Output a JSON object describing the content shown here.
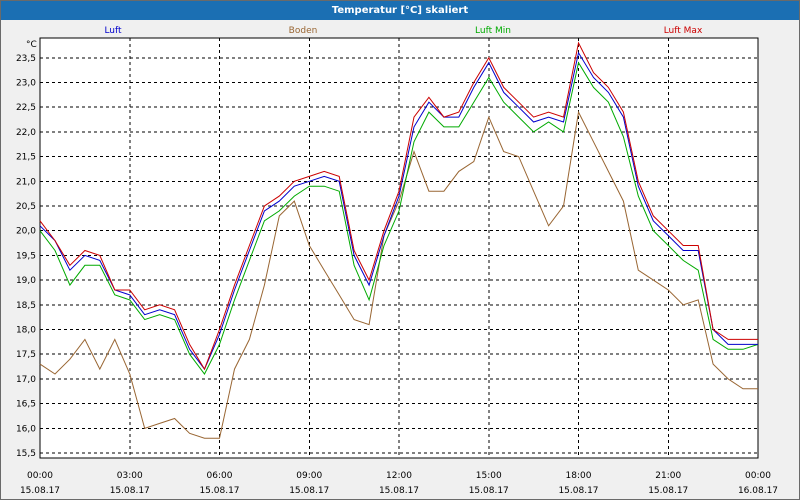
{
  "window": {
    "title": "Temperatur [°C] skaliert"
  },
  "colors": {
    "titlebar": "#1b6fb3",
    "plot_background": "#ffffff",
    "grid": "#000000",
    "luft": "#0000cc",
    "boden": "#996633",
    "luft_min": "#00aa00",
    "luft_max": "#cc0000"
  },
  "chart_data": {
    "type": "line",
    "title": "Temperatur [°C] skaliert",
    "ylabel": "°C",
    "ylim": [
      15.4,
      23.9
    ],
    "y_ticks": [
      15.5,
      16.0,
      16.5,
      17.0,
      17.5,
      18.0,
      18.5,
      19.0,
      19.5,
      20.0,
      20.5,
      21.0,
      21.5,
      22.0,
      22.5,
      23.0,
      23.5
    ],
    "y_tick_labels": [
      "15,5",
      "16,0",
      "16,5",
      "17,0",
      "17,5",
      "18,0",
      "18,5",
      "19,0",
      "19,5",
      "20,0",
      "20,5",
      "21,0",
      "21,5",
      "22,0",
      "22,5",
      "23,0",
      "23,5"
    ],
    "x_tick_labels": [
      {
        "time": "00:00",
        "date": "15.08.17"
      },
      {
        "time": "03:00",
        "date": "15.08.17"
      },
      {
        "time": "06:00",
        "date": "15.08.17"
      },
      {
        "time": "09:00",
        "date": "15.08.17"
      },
      {
        "time": "12:00",
        "date": "15.08.17"
      },
      {
        "time": "15:00",
        "date": "15.08.17"
      },
      {
        "time": "18:00",
        "date": "15.08.17"
      },
      {
        "time": "21:00",
        "date": "15.08.17"
      },
      {
        "time": "00:00",
        "date": "16.08.17"
      }
    ],
    "x_hours": [
      0,
      0.5,
      1,
      1.5,
      2,
      2.5,
      3,
      3.5,
      4,
      4.5,
      5,
      5.5,
      6,
      6.5,
      7,
      7.5,
      8,
      8.5,
      9,
      9.5,
      10,
      10.5,
      11,
      11.5,
      12,
      12.5,
      13,
      13.5,
      14,
      14.5,
      15,
      15.5,
      16,
      16.5,
      17,
      17.5,
      18,
      18.5,
      19,
      19.5,
      20,
      20.5,
      21,
      21.5,
      22,
      22.5,
      23,
      23.5,
      24
    ],
    "grid": true,
    "legend_position": "top",
    "series": [
      {
        "name": "Luft",
        "color": "#0000cc",
        "values": [
          20.1,
          19.8,
          19.2,
          19.5,
          19.4,
          18.8,
          18.7,
          18.3,
          18.4,
          18.3,
          17.6,
          17.2,
          17.9,
          18.8,
          19.6,
          20.4,
          20.6,
          20.9,
          21.0,
          21.1,
          21.0,
          19.5,
          18.9,
          19.9,
          20.7,
          22.1,
          22.6,
          22.3,
          22.3,
          22.9,
          23.4,
          22.8,
          22.5,
          22.2,
          22.3,
          22.2,
          23.6,
          23.1,
          22.8,
          22.3,
          20.9,
          20.2,
          19.9,
          19.6,
          19.6,
          18.0,
          17.7,
          17.7,
          17.7
        ]
      },
      {
        "name": "Boden",
        "color": "#996633",
        "values": [
          17.3,
          17.1,
          17.4,
          17.8,
          17.2,
          17.8,
          17.1,
          16.0,
          16.1,
          16.2,
          15.9,
          15.8,
          15.8,
          17.2,
          17.8,
          18.9,
          20.3,
          20.6,
          19.7,
          19.2,
          18.7,
          18.2,
          18.1,
          19.9,
          20.6,
          21.6,
          20.8,
          20.8,
          21.2,
          21.4,
          22.3,
          21.6,
          21.5,
          20.8,
          20.1,
          20.5,
          22.4,
          21.8,
          21.2,
          20.6,
          19.2,
          19.0,
          18.8,
          18.5,
          18.6,
          17.3,
          17.0,
          16.8,
          16.8
        ]
      },
      {
        "name": "Luft Min",
        "color": "#00aa00",
        "values": [
          20.0,
          19.6,
          18.9,
          19.3,
          19.3,
          18.7,
          18.6,
          18.2,
          18.3,
          18.2,
          17.5,
          17.1,
          17.7,
          18.6,
          19.4,
          20.2,
          20.4,
          20.7,
          20.9,
          20.9,
          20.8,
          19.3,
          18.6,
          19.7,
          20.4,
          21.8,
          22.4,
          22.1,
          22.1,
          22.6,
          23.1,
          22.6,
          22.3,
          22.0,
          22.2,
          22.0,
          23.4,
          22.9,
          22.6,
          21.9,
          20.7,
          20.0,
          19.7,
          19.4,
          19.2,
          17.8,
          17.6,
          17.6,
          17.7
        ]
      },
      {
        "name": "Luft Max",
        "color": "#cc0000",
        "values": [
          20.2,
          19.8,
          19.3,
          19.6,
          19.5,
          18.8,
          18.8,
          18.4,
          18.5,
          18.4,
          17.7,
          17.2,
          18.0,
          18.9,
          19.7,
          20.5,
          20.7,
          21.0,
          21.1,
          21.2,
          21.1,
          19.6,
          19.0,
          20.0,
          20.8,
          22.3,
          22.7,
          22.3,
          22.4,
          23.0,
          23.5,
          22.9,
          22.6,
          22.3,
          22.4,
          22.3,
          23.8,
          23.2,
          22.9,
          22.4,
          21.0,
          20.3,
          20.0,
          19.7,
          19.7,
          18.0,
          17.8,
          17.8,
          17.8
        ]
      }
    ]
  }
}
